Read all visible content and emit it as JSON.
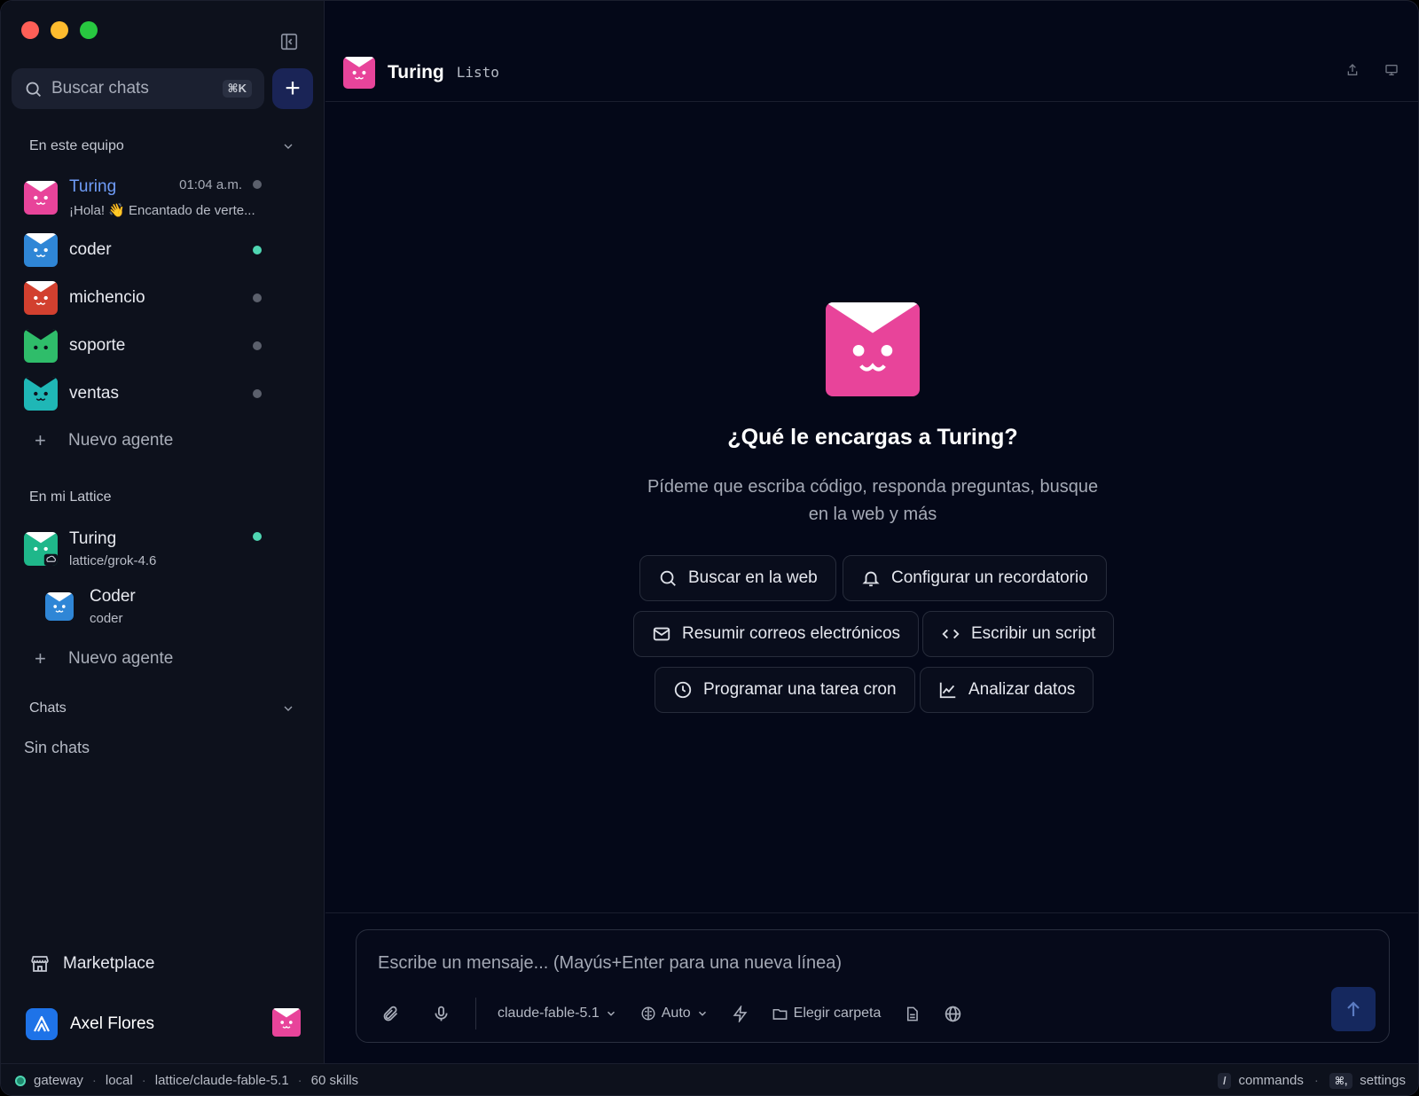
{
  "sidebar": {
    "search_placeholder": "Buscar chats",
    "search_shortcut": "⌘K",
    "section_team": "En este equipo",
    "team_agents": [
      {
        "name": "Turing",
        "time": "01:04 a.m.",
        "preview": "¡Hola! 👋 Encantado de verte...",
        "color": "#e8449a",
        "status": "offline"
      },
      {
        "name": "coder",
        "color": "#2f86d6",
        "status": "online"
      },
      {
        "name": "michencio",
        "color": "#d2402f",
        "status": "offline"
      },
      {
        "name": "soporte",
        "color": "#2fbd6a",
        "status": "offline"
      },
      {
        "name": "ventas",
        "color": "#1fb7b6",
        "status": "offline"
      }
    ],
    "new_agent": "Nuevo agente",
    "section_lattice": "En mi Lattice",
    "lattice_agents": [
      {
        "name": "Turing",
        "sub": "lattice/grok-4.6",
        "color": "#1fb78a",
        "status": "online"
      },
      {
        "name": "Coder",
        "sub": "coder",
        "color": "#2f86d6"
      }
    ],
    "section_chats": "Chats",
    "no_chats": "Sin chats",
    "marketplace": "Marketplace",
    "user_name": "Axel Flores"
  },
  "header": {
    "agent_name": "Turing",
    "state": "Listo"
  },
  "hero": {
    "title": "¿Qué le encargas a Turing?",
    "subtitle": "Pídeme que escriba código, responda preguntas, busque en la web y más"
  },
  "suggestions": [
    {
      "label": "Buscar en la web",
      "icon": "search-icon"
    },
    {
      "label": "Configurar un recordatorio",
      "icon": "bell-icon"
    },
    {
      "label": "Resumir correos electrónicos",
      "icon": "mail-icon"
    },
    {
      "label": "Escribir un script",
      "icon": "code-icon"
    },
    {
      "label": "Programar una tarea cron",
      "icon": "clock-icon"
    },
    {
      "label": "Analizar datos",
      "icon": "chart-icon"
    }
  ],
  "composer": {
    "placeholder": "Escribe un mensaje... (Mayús+Enter para una nueva línea)",
    "model": "claude-fable-5.1",
    "mode": "Auto",
    "folder": "Elegir carpeta"
  },
  "status": {
    "gateway": "gateway",
    "env": "local",
    "model": "lattice/claude-fable-5.1",
    "skills": "60 skills",
    "commands_key": "/",
    "commands": "commands",
    "settings_key": "⌘,",
    "settings": "settings"
  },
  "colors": {
    "accent": "#e8449a",
    "online": "#4fd6b2",
    "background": "#040818"
  }
}
